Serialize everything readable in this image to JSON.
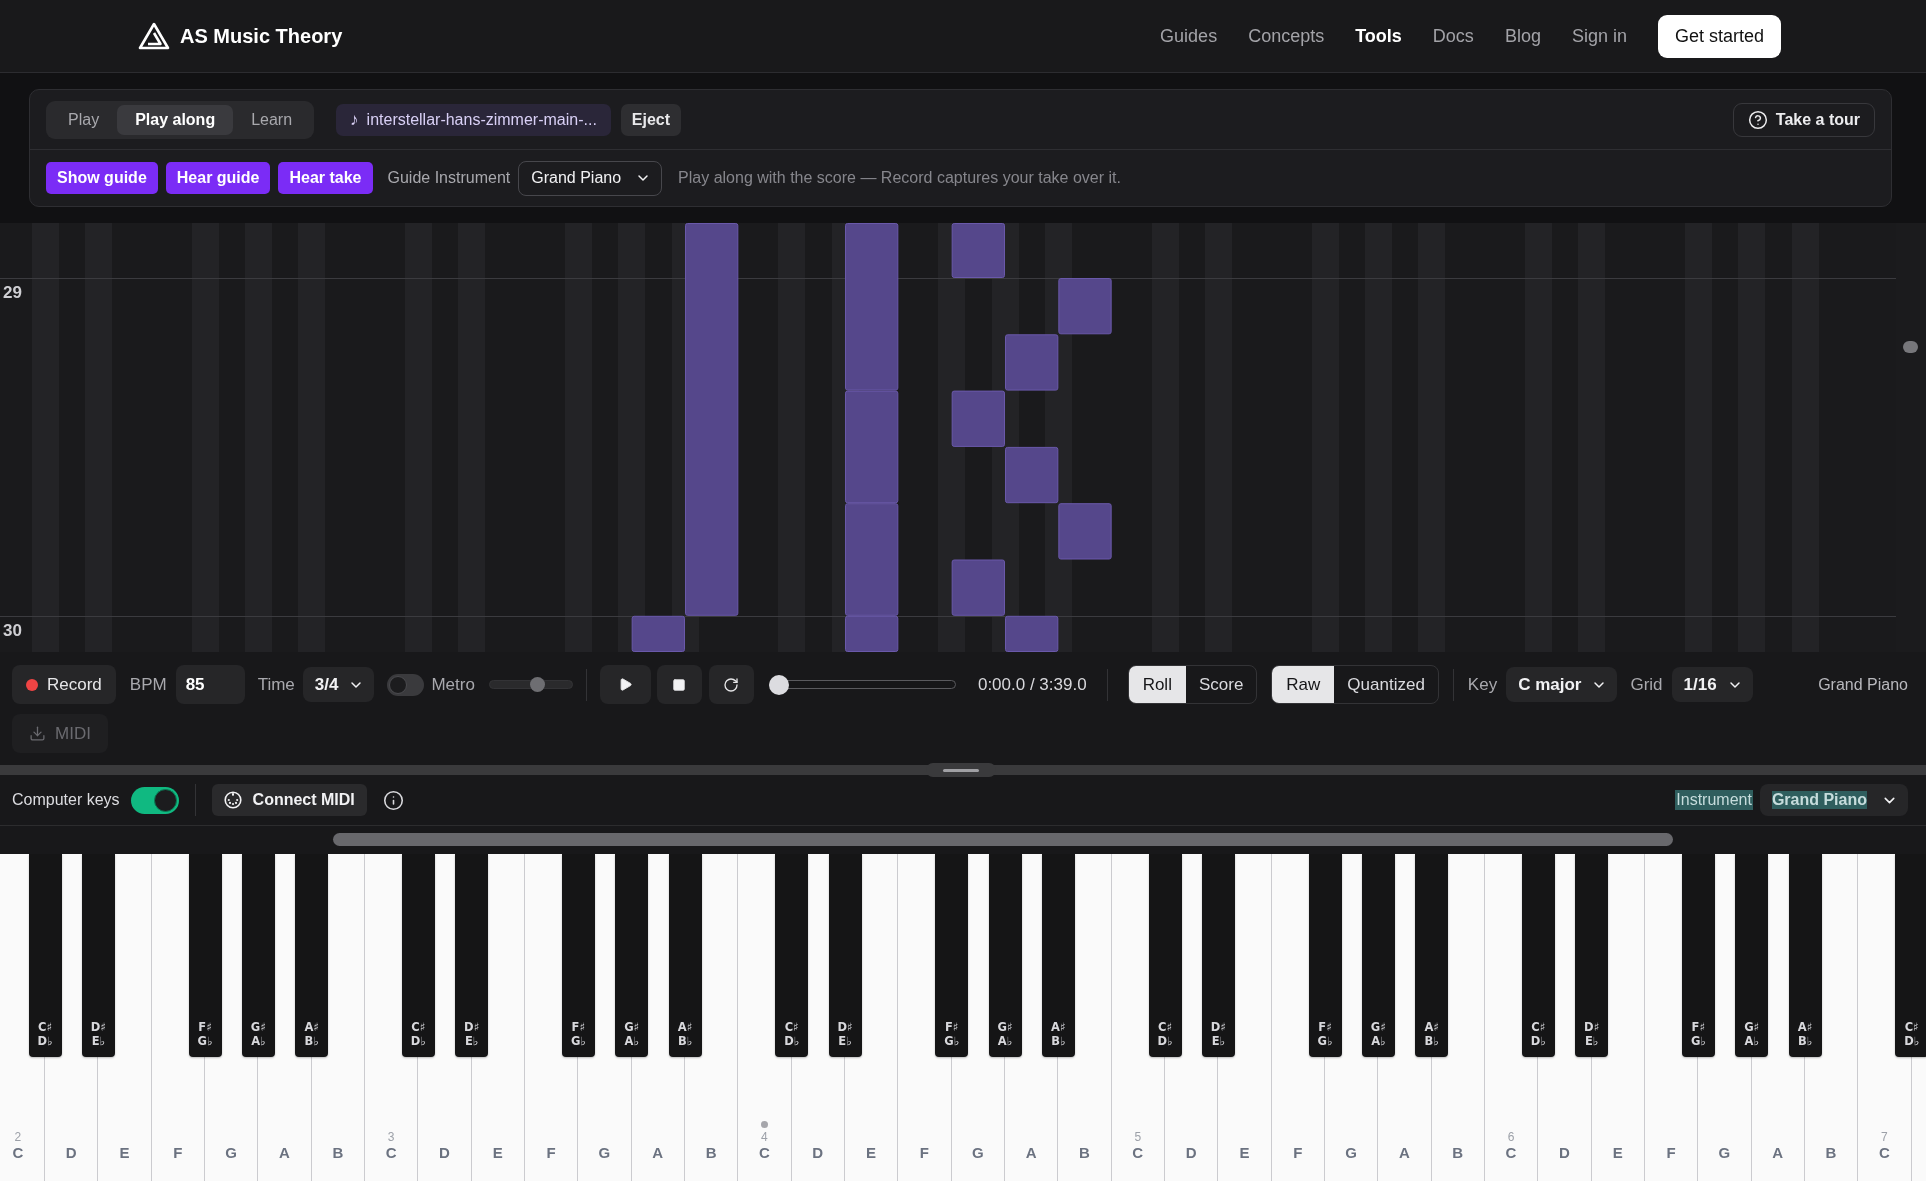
{
  "nav": {
    "brand": "AS Music Theory",
    "links": [
      {
        "label": "Guides",
        "selected": false
      },
      {
        "label": "Concepts",
        "selected": false
      },
      {
        "label": "Tools",
        "selected": true
      },
      {
        "label": "Docs",
        "selected": false
      },
      {
        "label": "Blog",
        "selected": false
      },
      {
        "label": "Sign in",
        "selected": false
      }
    ],
    "cta": "Get started"
  },
  "toolbar": {
    "modes": [
      {
        "label": "Play",
        "selected": false
      },
      {
        "label": "Play along",
        "selected": true
      },
      {
        "label": "Learn",
        "selected": false
      }
    ],
    "file": {
      "icon": "♪",
      "name": "interstellar-hans-zimmer-main-..."
    },
    "eject": "Eject",
    "tour": "Take a tour"
  },
  "guide_bar": {
    "toggles": [
      {
        "label": "Show guide",
        "on": true
      },
      {
        "label": "Hear guide",
        "on": true
      },
      {
        "label": "Hear take",
        "on": true
      }
    ],
    "instrument": {
      "label": "Guide Instrument",
      "value": "Grand Piano"
    },
    "hint": "Play along with the score — Record captures your take over it."
  },
  "piano_roll": {
    "measures": [
      "29",
      "30"
    ]
  },
  "transport": {
    "record": "Record",
    "bpm": {
      "label": "BPM",
      "value": "85"
    },
    "time_signature": {
      "label": "Time",
      "value": "3/4"
    },
    "metronome": {
      "label": "Metro",
      "on": false,
      "level": 0.58
    },
    "position": {
      "level": 0
    },
    "readout": "0:00.0 / 3:39.0",
    "views": [
      {
        "label": "Roll",
        "selected": true
      },
      {
        "label": "Score",
        "selected": false
      }
    ],
    "timing": [
      {
        "label": "Raw",
        "selected": true
      },
      {
        "label": "Quantized",
        "selected": false
      }
    ],
    "key": {
      "label": "Key",
      "value": "C major"
    },
    "grid": {
      "label": "Grid",
      "value": "1/16"
    },
    "instrument": "Grand Piano",
    "midi_export": {
      "label": "MIDI",
      "disabled": true
    }
  },
  "input_bar": {
    "computer_keys": {
      "label": "Computer keys",
      "on": true
    },
    "connect_midi": "Connect MIDI",
    "instrument": {
      "label": "Instrument",
      "value": "Grand Piano",
      "highlighted": true
    }
  },
  "keyboard": {
    "octaves": [
      {
        "label": "2",
        "dot": false,
        "white_keys": [
          "C",
          "D",
          "E",
          "F",
          "G",
          "A",
          "B"
        ],
        "black_keys": [
          {
            "sharp": "C♯",
            "flat": "D♭"
          },
          {
            "sharp": "D♯",
            "flat": "E♭"
          },
          {
            "sharp": "F♯",
            "flat": "G♭"
          },
          {
            "sharp": "G♯",
            "flat": "A♭"
          },
          {
            "sharp": "A♯",
            "flat": "B♭"
          }
        ]
      },
      {
        "label": "3",
        "dot": false,
        "white_keys": [
          "C",
          "D",
          "E",
          "F",
          "G",
          "A",
          "B"
        ],
        "black_keys": [
          {
            "sharp": "C♯",
            "flat": "D♭"
          },
          {
            "sharp": "D♯",
            "flat": "E♭"
          },
          {
            "sharp": "F♯",
            "flat": "G♭"
          },
          {
            "sharp": "G♯",
            "flat": "A♭"
          },
          {
            "sharp": "A♯",
            "flat": "B♭"
          }
        ]
      },
      {
        "label": "4",
        "dot": true,
        "white_keys": [
          "C",
          "D",
          "E",
          "F",
          "G",
          "A",
          "B"
        ],
        "black_keys": [
          {
            "sharp": "C♯",
            "flat": "D♭"
          },
          {
            "sharp": "D♯",
            "flat": "E♭"
          },
          {
            "sharp": "F♯",
            "flat": "G♭"
          },
          {
            "sharp": "G♯",
            "flat": "A♭"
          },
          {
            "sharp": "A♯",
            "flat": "B♭"
          }
        ]
      },
      {
        "label": "5",
        "dot": false,
        "white_keys": [
          "C",
          "D",
          "E",
          "F",
          "G",
          "A",
          "B"
        ],
        "black_keys": [
          {
            "sharp": "C♯",
            "flat": "D♭"
          },
          {
            "sharp": "D♯",
            "flat": "E♭"
          },
          {
            "sharp": "F♯",
            "flat": "G♭"
          },
          {
            "sharp": "G♯",
            "flat": "A♭"
          },
          {
            "sharp": "A♯",
            "flat": "B♭"
          }
        ]
      },
      {
        "label": "6",
        "dot": false,
        "white_keys": [
          "C",
          "D",
          "E",
          "F",
          "G",
          "A",
          "B"
        ],
        "black_keys": [
          {
            "sharp": "C♯",
            "flat": "D♭"
          },
          {
            "sharp": "D♯",
            "flat": "E♭"
          },
          {
            "sharp": "F♯",
            "flat": "G♭"
          },
          {
            "sharp": "G♯",
            "flat": "A♭"
          },
          {
            "sharp": "A♯",
            "flat": "B♭"
          }
        ]
      },
      {
        "label": "7",
        "dot": false,
        "white_keys": [
          "C"
        ],
        "black_keys": [
          {
            "sharp": "C♯",
            "flat": "D♭"
          }
        ]
      }
    ]
  }
}
